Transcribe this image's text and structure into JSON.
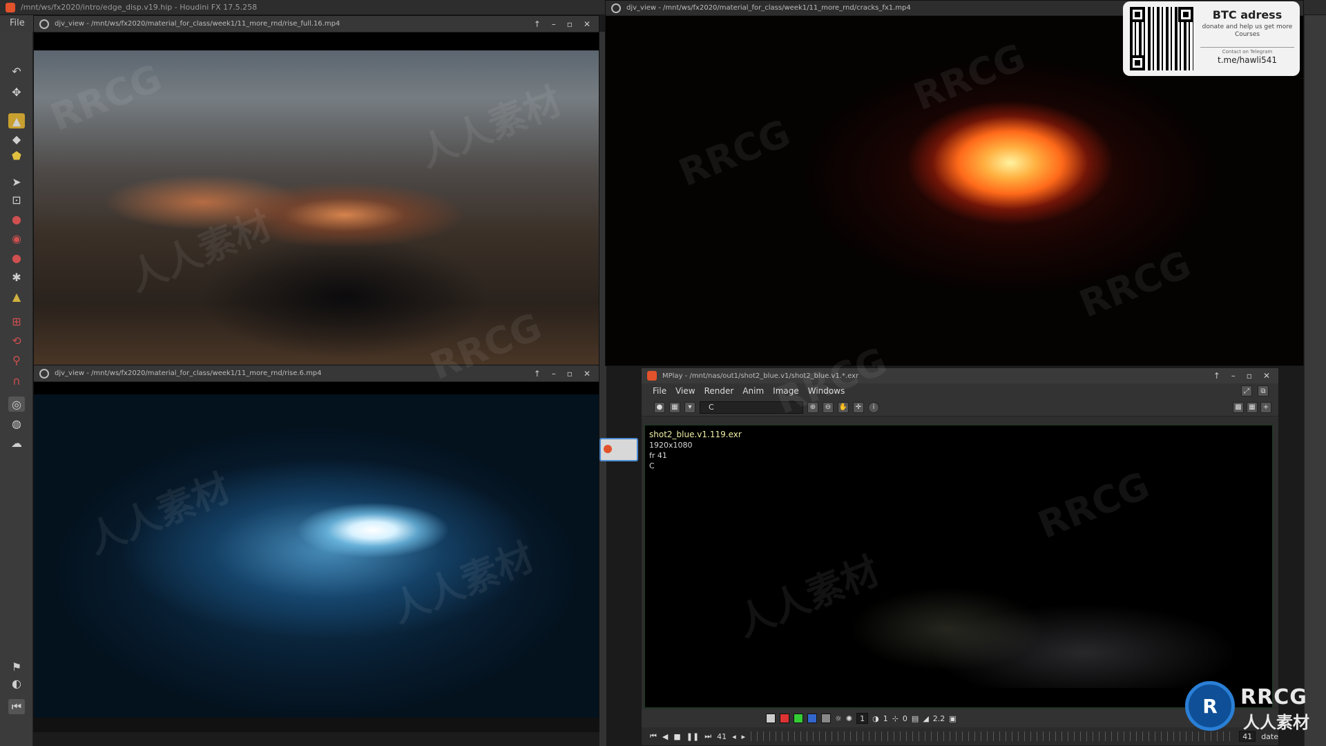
{
  "houdini": {
    "title": "/mnt/ws/fx2020/intro/edge_disp.v19.hip - Houdini FX 17.5.258",
    "menu_file": "File"
  },
  "windows": {
    "top_left": {
      "title": "djv_view - /mnt/ws/fx2020/material_for_class/week1/11_more_rnd/rise_full.16.mp4"
    },
    "bottom_left": {
      "title": "djv_view - /mnt/ws/fx2020/material_for_class/week1/11_more_rnd/rise.6.mp4"
    },
    "top_right": {
      "title": "djv_view - /mnt/ws/fx2020/material_for_class/week1/11_more_rnd/cracks_fx1.mp4"
    }
  },
  "mplay": {
    "title": "MPlay - /mnt/nas/out1/shot2_blue.v1/shot2_blue.v1.*.exr",
    "menu": [
      "File",
      "View",
      "Render",
      "Anim",
      "Image",
      "Windows"
    ],
    "plane": "C",
    "info": {
      "filename": "shot2_blue.v1.119.exr",
      "resolution": "1920x1080",
      "frame": "fr 41",
      "channel": "C"
    },
    "bottom": {
      "step": "1",
      "gamma_a": "1",
      "offset": "0",
      "gamma": "2.2",
      "current_frame": "41",
      "end_frame": "41",
      "update": "date"
    },
    "frame_ticks": [
      "1",
      "2",
      "3",
      "4",
      "5",
      "6",
      "7",
      "8",
      "9",
      "10",
      "11",
      "12",
      "13",
      "14",
      "15",
      "16",
      "17",
      "18",
      "19",
      "20",
      "21",
      "22",
      "23",
      "24",
      "25",
      "26",
      "27",
      "28",
      "29",
      "30",
      "31",
      "32",
      "33",
      "34",
      "35",
      "36",
      "37",
      "38",
      "39",
      "40",
      "41",
      "42"
    ]
  },
  "banner": {
    "title": "BTC adress",
    "subtitle": "donate and help us get more Courses",
    "contact": "Contact on Telegram",
    "handle": "t.me/hawli541"
  },
  "watermark": {
    "brand": "RRCG",
    "cn": "人人素材"
  },
  "icons": {
    "window_menu": "gear-icon",
    "minimize": "minimize-icon",
    "maximize": "maximize-icon",
    "close": "close-icon",
    "pin": "pin-icon"
  }
}
